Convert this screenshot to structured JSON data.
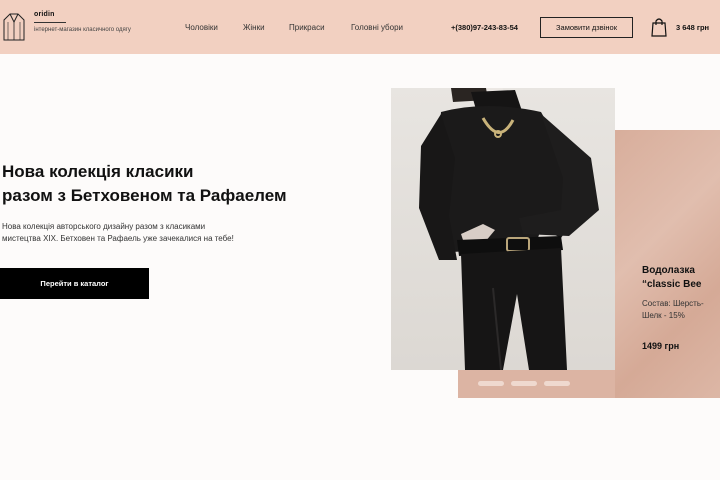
{
  "header": {
    "brand": "oridin",
    "tagline": "інтернет-магазин класичного одягу",
    "nav": [
      "Чоловіки",
      "Жінки",
      "Прикраси",
      "Головні убори"
    ],
    "phone": "+(380)97-243-83-54",
    "callback_label": "Замовити дзвінок",
    "cart_total": "3 648 грн"
  },
  "hero": {
    "title_line1": "Нова колекція класики",
    "title_line2": "разом з Бетховеном та Рафаелем",
    "description": "Нова колекція авторського дизайну разом з класиками мистецтва XIX. Бетховен та Рафаель уже зачекалися на тебе!",
    "cta_label": "Перейти в каталог"
  },
  "product": {
    "name_line1": "Водолазка",
    "name_line2": "“classic Bee",
    "composition_line1": "Состав: Шерсть-",
    "composition_line2": "Шелк - 15%",
    "price": "1499 грн"
  },
  "colors": {
    "header_bg": "#f2d0c1",
    "card_bg": "#dcb4a3",
    "button_bg": "#000000"
  }
}
